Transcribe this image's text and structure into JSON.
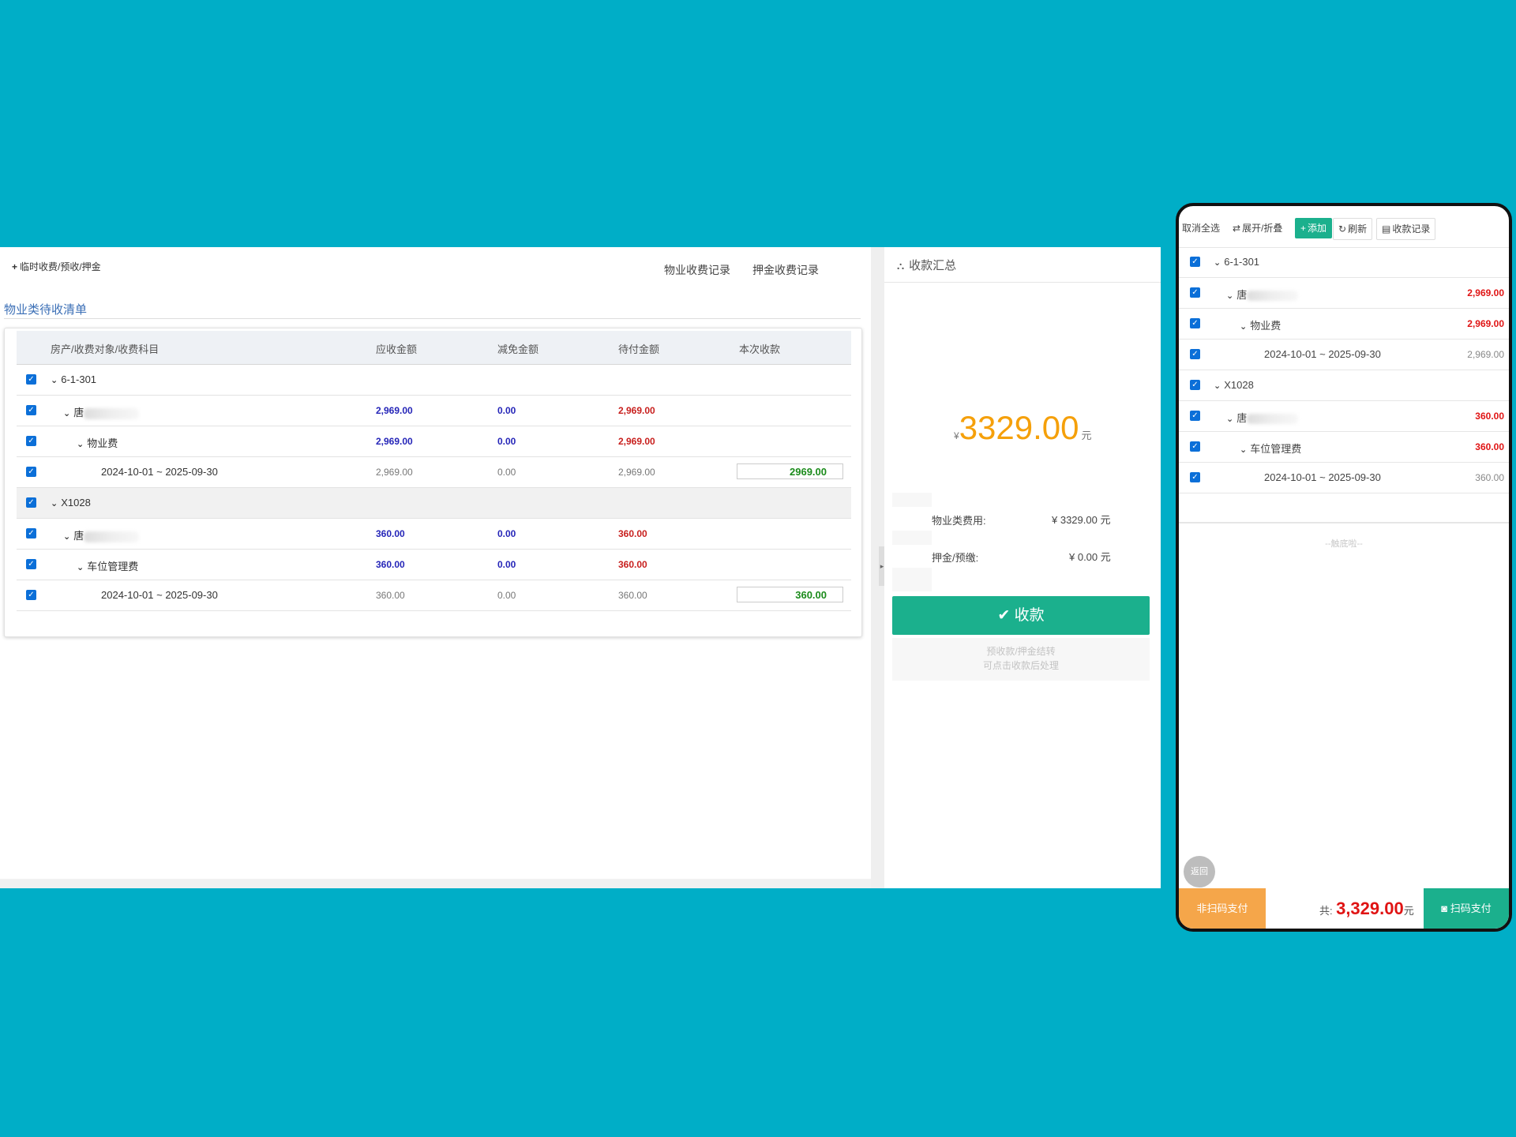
{
  "desktop": {
    "temp_link": "临时收费/预收/押金",
    "top_links": [
      "物业收费记录",
      "押金收费记录"
    ],
    "section_title": "物业类待收清单",
    "columns": [
      "房产/收费对象/收费科目",
      "应收金额",
      "减免金额",
      "待付金额",
      "本次收款"
    ],
    "rows": [
      {
        "label": "6-1-301",
        "receivable": "",
        "discount": "",
        "pending": "",
        "pay": ""
      },
      {
        "label": "唐",
        "receivable": "2,969.00",
        "discount": "0.00",
        "pending": "2,969.00",
        "pay": ""
      },
      {
        "label": "物业费",
        "receivable": "2,969.00",
        "discount": "0.00",
        "pending": "2,969.00",
        "pay": ""
      },
      {
        "label": "2024-10-01 ~ 2025-09-30",
        "receivable": "2,969.00",
        "discount": "0.00",
        "pending": "2,969.00",
        "pay": "2969.00"
      },
      {
        "label": "X1028",
        "receivable": "",
        "discount": "",
        "pending": "",
        "pay": ""
      },
      {
        "label": "唐",
        "receivable": "360.00",
        "discount": "0.00",
        "pending": "360.00",
        "pay": ""
      },
      {
        "label": "车位管理费",
        "receivable": "360.00",
        "discount": "0.00",
        "pending": "360.00",
        "pay": ""
      },
      {
        "label": "2024-10-01 ~ 2025-09-30",
        "receivable": "360.00",
        "discount": "0.00",
        "pending": "360.00",
        "pay": "360.00"
      }
    ]
  },
  "summary": {
    "title": "收款汇总",
    "currency": "¥",
    "total": "3329.00",
    "unit": "元",
    "property_label": "物业类费用:",
    "property_value": "¥ 3329.00 元",
    "deposit_label": "押金/预缴:",
    "deposit_value": "¥ 0.00 元",
    "pay_button": "收款",
    "note_line1": "预收款/押金结转",
    "note_line2": "可点击收款后处理"
  },
  "mobile": {
    "toolbar": {
      "deselect_all": "取消全选",
      "expand_collapse": "展开/折叠",
      "add": "添加",
      "refresh": "刷新",
      "records": "收款记录"
    },
    "rows": [
      {
        "label": "6-1-301",
        "amount": ""
      },
      {
        "label": "唐",
        "amount": "2,969.00"
      },
      {
        "label": "物业费",
        "amount": "2,969.00"
      },
      {
        "label": "2024-10-01 ~ 2025-09-30",
        "amount": "2,969.00"
      },
      {
        "label": "X1028",
        "amount": ""
      },
      {
        "label": "唐",
        "amount": "360.00"
      },
      {
        "label": "车位管理费",
        "amount": "360.00"
      },
      {
        "label": "2024-10-01 ~ 2025-09-30",
        "amount": "360.00"
      }
    ],
    "bottom_text": "--触底啦--",
    "back": "返回",
    "non_scan": "非扫码支付",
    "total_prefix": "共:",
    "total_value": "3,329.00",
    "total_unit": "元",
    "scan": "扫码支付"
  },
  "colors": {
    "background": "#00aec7",
    "accent_green": "#1bb08d",
    "amount_orange": "#f5a00a",
    "amount_red": "#e01414",
    "amount_blue": "#2525b8",
    "link_blue": "#3b6fb6",
    "button_orange": "#f5a64a"
  },
  "icons": [
    "plus-icon",
    "sitemap-icon",
    "check-icon",
    "chevron-down-icon",
    "checkbox-icon",
    "swap-icon",
    "refresh-icon",
    "file-icon",
    "camera-icon",
    "collapse-arrow-icon"
  ]
}
